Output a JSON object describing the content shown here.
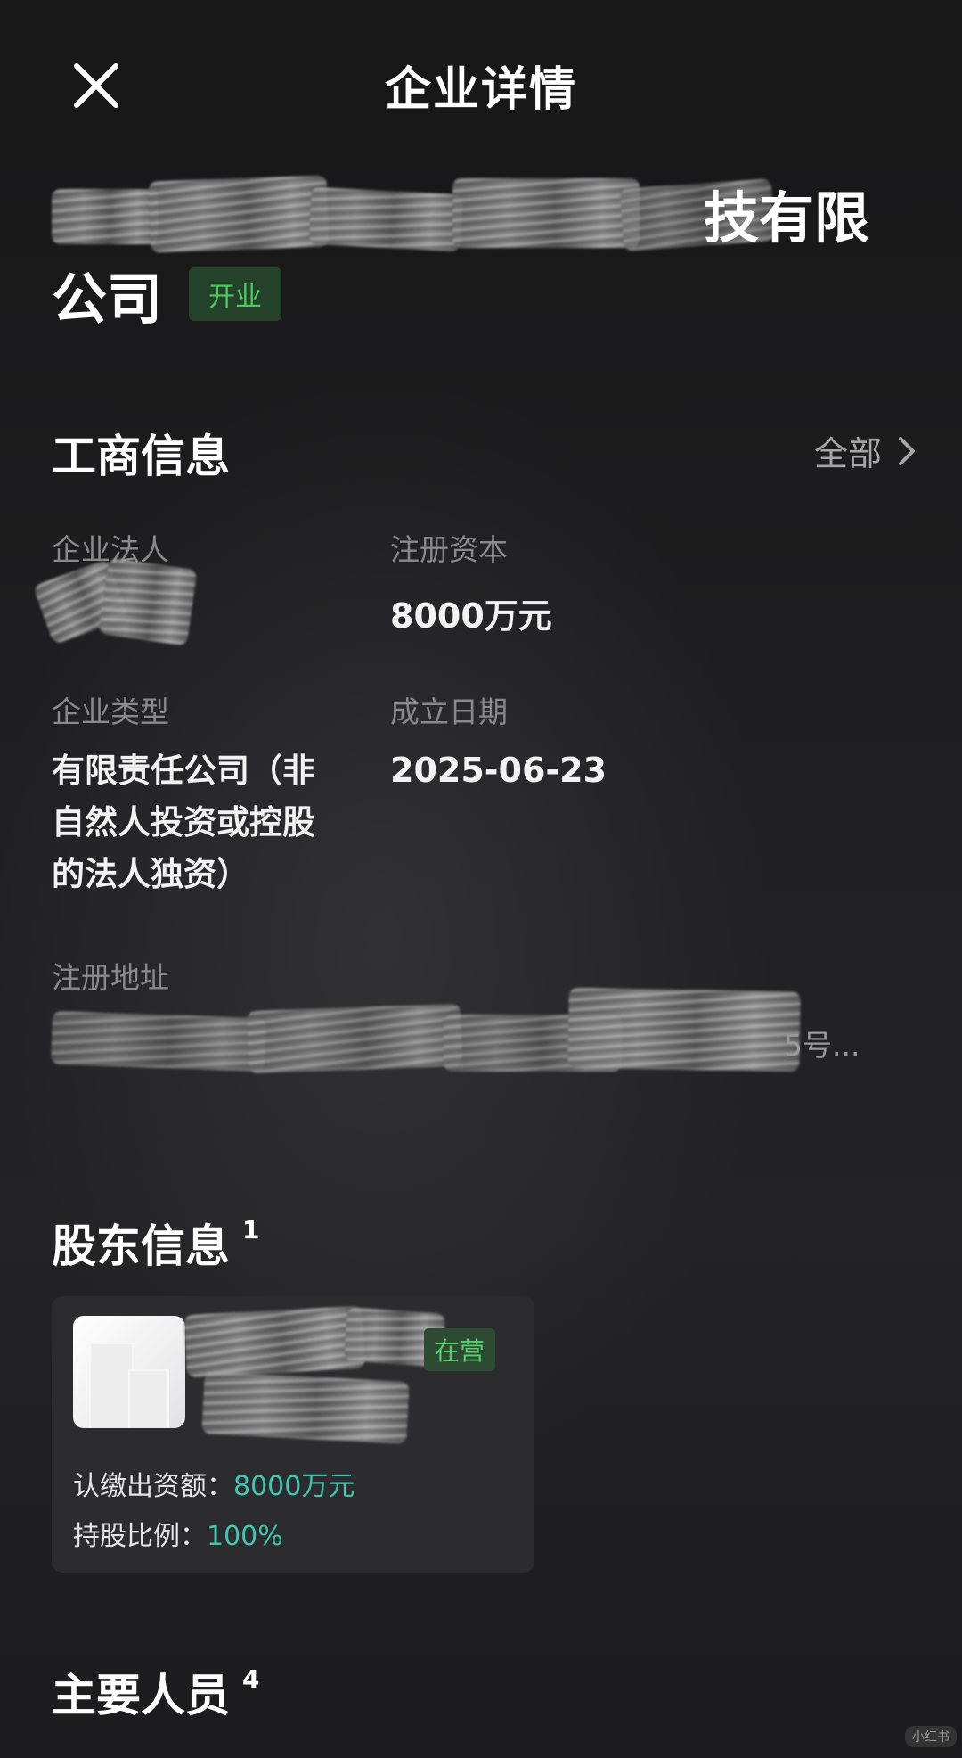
{
  "header": {
    "title": "企业详情"
  },
  "company": {
    "name_visible_tail": "技有限",
    "name_line2": "公司",
    "status": "开业"
  },
  "business_info": {
    "title": "工商信息",
    "more_label": "全部",
    "legal_person_label": "企业法人",
    "registered_capital_label": "注册资本",
    "registered_capital_value": "8000万元",
    "company_type_label": "企业类型",
    "company_type_value": "有限责任公司（非自然人投资或控股的法人独资）",
    "founded_label": "成立日期",
    "founded_value": "2025-06-23",
    "address_label": "注册地址",
    "address_visible_tail": "5号..."
  },
  "shareholders": {
    "title": "股东信息",
    "count": "1",
    "items": [
      {
        "status": "在营",
        "subscribed_label": "认缴出资额：",
        "subscribed_value": "8000万元",
        "ratio_label": "持股比例：",
        "ratio_value": "100%"
      }
    ]
  },
  "key_personnel": {
    "title": "主要人员",
    "count": "4"
  },
  "colors": {
    "status_green": "#4fca63",
    "value_teal": "#3fc6b5",
    "label_gray": "#8a8a8c"
  },
  "watermark": "小红书"
}
